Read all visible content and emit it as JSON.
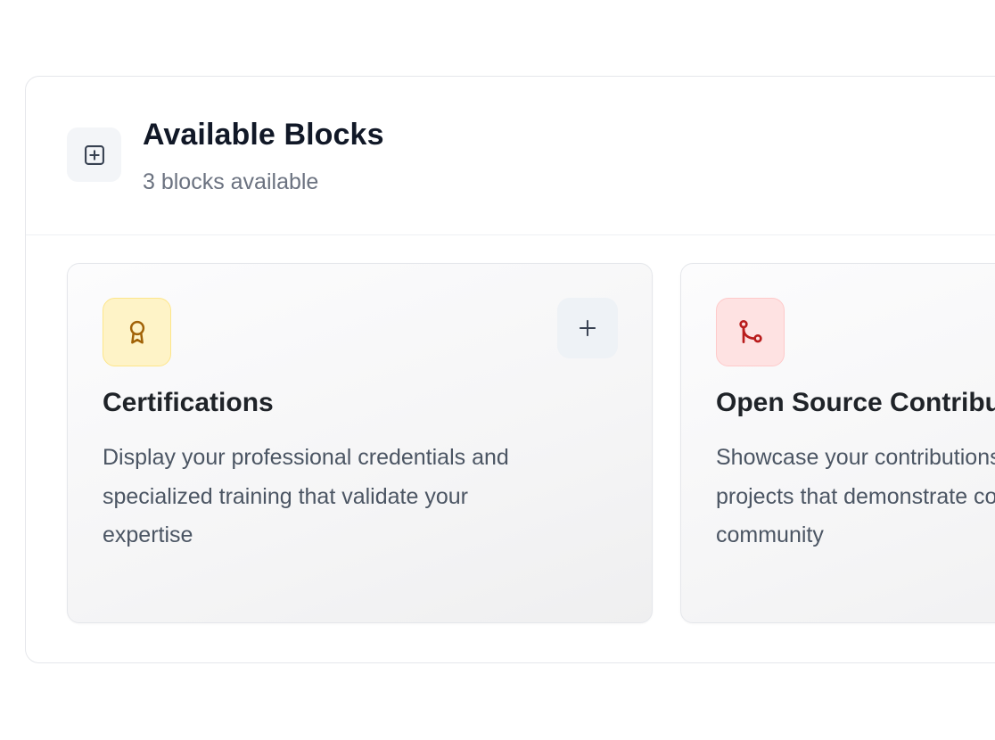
{
  "panel": {
    "title": "Available Blocks",
    "subtitle": "3 blocks available",
    "header_icon": "plus-square-icon"
  },
  "cards": [
    {
      "title": "Certifications",
      "description": "Display your professional credentials and specialized training that validate your expertise",
      "icon": "award-icon",
      "icon_bg": "#fef3c7",
      "icon_border": "#fde68a",
      "icon_color": "#a16207",
      "add_icon": "plus-icon"
    },
    {
      "title": "Open Source Contributions",
      "description": "Showcase your contributions to open source projects that demonstrate commitment to the community",
      "icon": "git-merge-icon",
      "icon_bg": "#fee2e2",
      "icon_border": "#fecaca",
      "icon_color": "#b91c1c"
    }
  ]
}
